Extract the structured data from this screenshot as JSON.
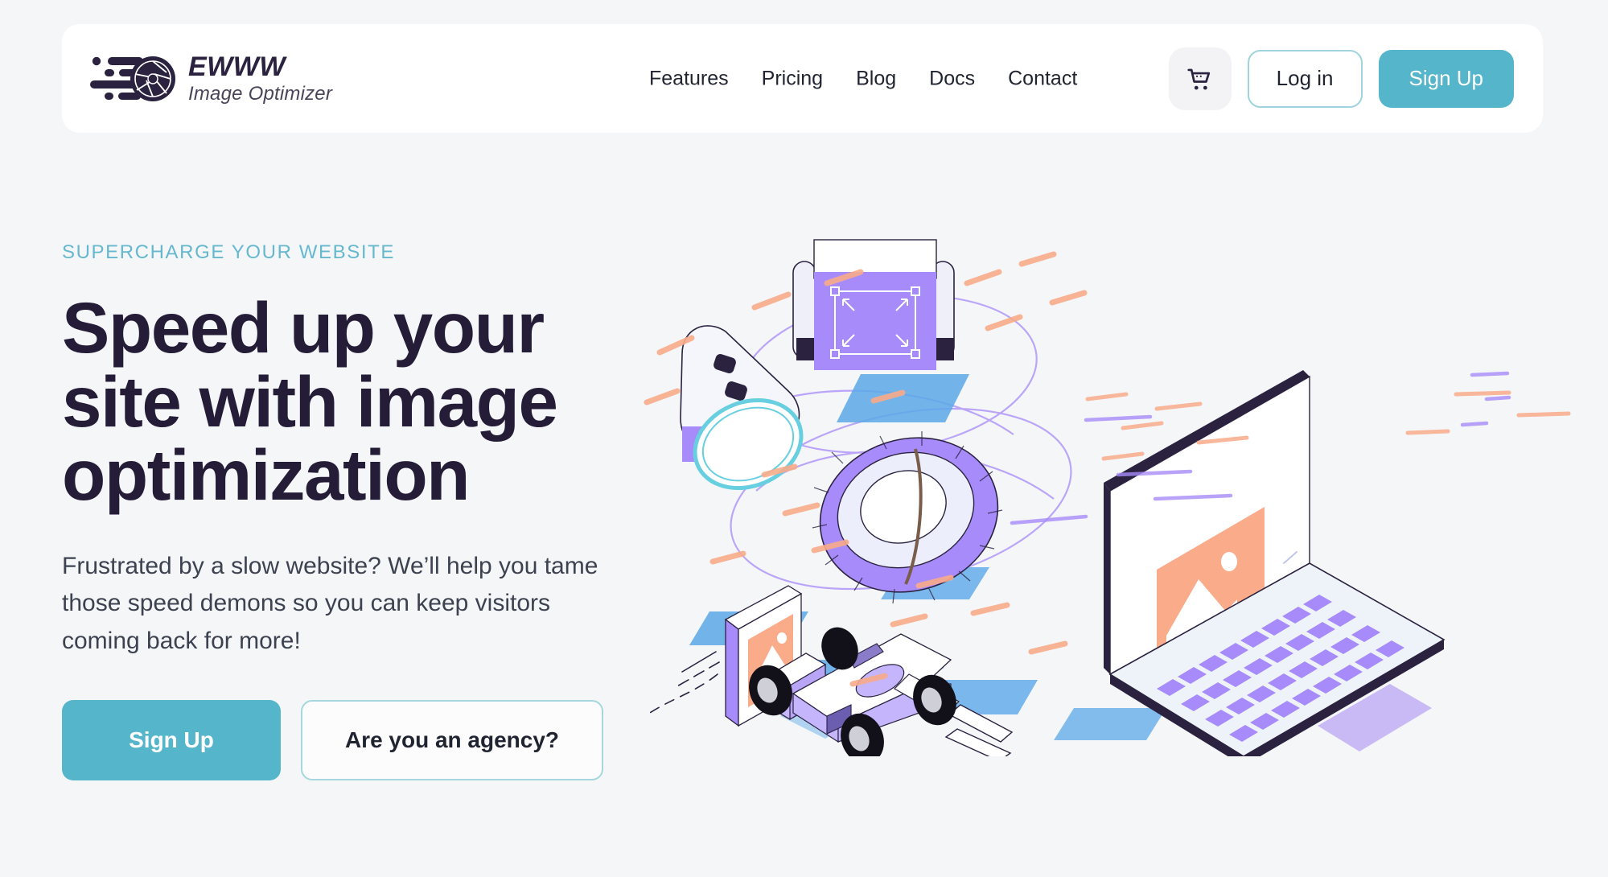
{
  "brand": {
    "name": "EWWW",
    "tagline": "Image Optimizer",
    "accent_teal": "#55b5ca",
    "accent_teal_light": "#66b8cf",
    "heading_color": "#251c38",
    "page_background": "#f5f6f8",
    "header_background": "#ffffff"
  },
  "header": {
    "nav": [
      {
        "label": "Features"
      },
      {
        "label": "Pricing"
      },
      {
        "label": "Blog"
      },
      {
        "label": "Docs"
      },
      {
        "label": "Contact"
      }
    ],
    "cart_icon": "shopping-cart-icon",
    "login_label": "Log in",
    "signup_label": "Sign Up"
  },
  "hero": {
    "eyebrow": "SUPERCHARGE YOUR WEBSITE",
    "title": "Speed up your site with image optimization",
    "subtitle": "Frustrated by a slow website? We’ll help you tame those speed demons so you can keep visitors coming back for more!",
    "primary_cta": "Sign Up",
    "secondary_cta": "Are you an agency?",
    "illustration": {
      "name": "isometric-speed-optimization-illustration",
      "elements": [
        "laptop-with-image-placeholder",
        "formula-one-race-car",
        "floating-image-card",
        "purple-roller-with-crop-icon",
        "speed-gauge-dial",
        "purple-tire-ring",
        "orange-speed-dashes",
        "purple-swoosh-loops"
      ],
      "colors": {
        "purple": "#a78bfa",
        "purple_light": "#c4b5fd",
        "orange": "#f9ab8a",
        "blue": "#5ba8e8",
        "navy": "#2b2240",
        "teal": "#67cfe0"
      }
    }
  }
}
